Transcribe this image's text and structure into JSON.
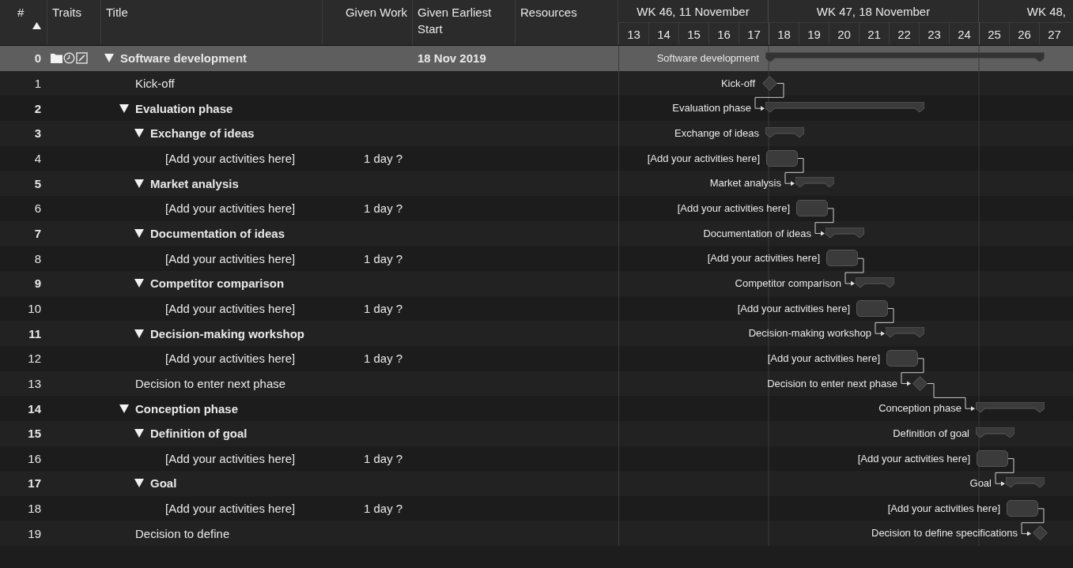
{
  "columns": [
    {
      "label": "#",
      "sorted": true
    },
    {
      "label": "Traits",
      "sorted": false
    },
    {
      "label": "Title",
      "sorted": false
    },
    {
      "label": "Given Work",
      "sorted": false
    },
    {
      "label": "Given Earliest Start",
      "sorted": false
    },
    {
      "label": "Resources",
      "sorted": false
    }
  ],
  "timeline": {
    "weeks": [
      {
        "label": "WK 46, 11 November",
        "days": [
          "13",
          "14",
          "15",
          "16",
          "17"
        ]
      },
      {
        "label": "WK 47, 18 November",
        "days": [
          "18",
          "19",
          "20",
          "21",
          "22",
          "23",
          "24"
        ]
      },
      {
        "label": "WK 48,",
        "days": [
          "25",
          "26",
          "27"
        ]
      }
    ]
  },
  "tasks": [
    {
      "number": "0",
      "title": "Software development",
      "kind": "summary",
      "expanded": true,
      "selected": true,
      "traits": true,
      "linked": false,
      "given_earliest_start": "18 Nov 2019",
      "gantt_label": "Software development",
      "children": [
        {
          "number": "1",
          "title": "Kick-off",
          "kind": "milestone",
          "selected": false,
          "traits": false,
          "linked": false,
          "gantt_label": "Kick-off"
        },
        {
          "number": "2",
          "title": "Evaluation phase",
          "kind": "summary",
          "expanded": true,
          "selected": false,
          "traits": false,
          "linked": true,
          "gantt_label": "Evaluation phase",
          "children": [
            {
              "number": "3",
              "title": "Exchange of ideas",
              "kind": "summary",
              "expanded": true,
              "selected": false,
              "traits": false,
              "linked": false,
              "gantt_label": "Exchange of ideas",
              "children": [
                {
                  "number": "4",
                  "title": "[Add your activities here]",
                  "kind": "task",
                  "selected": false,
                  "traits": false,
                  "linked": false,
                  "given_work": "1 day ?",
                  "gantt_label": "[Add your activities here]"
                }
              ]
            },
            {
              "number": "5",
              "title": "Market analysis",
              "kind": "summary",
              "expanded": true,
              "selected": false,
              "traits": false,
              "linked": true,
              "gantt_label": "Market analysis",
              "children": [
                {
                  "number": "6",
                  "title": "[Add your activities here]",
                  "kind": "task",
                  "selected": false,
                  "traits": false,
                  "linked": false,
                  "given_work": "1 day ?",
                  "gantt_label": "[Add your activities here]"
                }
              ]
            },
            {
              "number": "7",
              "title": "Documentation of ideas",
              "kind": "summary",
              "expanded": true,
              "selected": false,
              "traits": false,
              "linked": true,
              "gantt_label": "Documentation of ideas",
              "children": [
                {
                  "number": "8",
                  "title": "[Add your activities here]",
                  "kind": "task",
                  "selected": false,
                  "traits": false,
                  "linked": false,
                  "given_work": "1 day ?",
                  "gantt_label": "[Add your activities here]"
                }
              ]
            },
            {
              "number": "9",
              "title": "Competitor comparison",
              "kind": "summary",
              "expanded": true,
              "selected": false,
              "traits": false,
              "linked": true,
              "gantt_label": "Competitor comparison",
              "children": [
                {
                  "number": "10",
                  "title": "[Add your activities here]",
                  "kind": "task",
                  "selected": false,
                  "traits": false,
                  "linked": false,
                  "given_work": "1 day ?",
                  "gantt_label": "[Add your activities here]"
                }
              ]
            },
            {
              "number": "11",
              "title": "Decision-making workshop",
              "kind": "summary",
              "expanded": true,
              "selected": false,
              "traits": false,
              "linked": true,
              "gantt_label": "Decision-making workshop",
              "children": [
                {
                  "number": "12",
                  "title": "[Add your activities here]",
                  "kind": "task",
                  "selected": false,
                  "traits": false,
                  "linked": false,
                  "given_work": "1 day ?",
                  "gantt_label": "[Add your activities here]"
                }
              ]
            }
          ]
        },
        {
          "number": "13",
          "title": "Decision to enter next phase",
          "kind": "milestone",
          "selected": false,
          "traits": false,
          "linked": true,
          "gantt_label": "Decision to enter next phase"
        },
        {
          "number": "14",
          "title": "Conception phase",
          "kind": "summary",
          "expanded": true,
          "selected": false,
          "traits": false,
          "linked": true,
          "gantt_label": "Conception phase",
          "children": [
            {
              "number": "15",
              "title": "Definition of goal",
              "kind": "summary",
              "expanded": true,
              "selected": false,
              "traits": false,
              "linked": false,
              "gantt_label": "Definition of goal",
              "children": [
                {
                  "number": "16",
                  "title": "[Add your activities here]",
                  "kind": "task",
                  "selected": false,
                  "traits": false,
                  "linked": false,
                  "given_work": "1 day ?",
                  "gantt_label": "[Add your activities here]"
                }
              ]
            },
            {
              "number": "17",
              "title": "Goal",
              "kind": "summary",
              "expanded": true,
              "selected": false,
              "traits": false,
              "linked": true,
              "gantt_label": "Goal",
              "children": [
                {
                  "number": "18",
                  "title": "[Add your activities here]",
                  "kind": "task",
                  "selected": false,
                  "traits": false,
                  "linked": false,
                  "given_work": "1 day ?",
                  "gantt_label": "[Add your activities here]"
                }
              ]
            }
          ]
        },
        {
          "number": "19",
          "title": "Decision to define",
          "kind": "milestone",
          "selected": false,
          "traits": false,
          "linked": true,
          "gantt_label": "Decision to define specifications"
        }
      ]
    }
  ]
}
